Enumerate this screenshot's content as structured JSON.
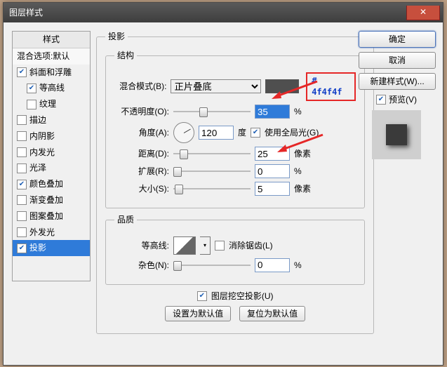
{
  "window": {
    "title": "图层样式"
  },
  "styles": {
    "header": "样式",
    "items": [
      {
        "label": "混合选项:默认",
        "default": true
      },
      {
        "label": "斜面和浮雕",
        "checked": true
      },
      {
        "label": "等高线",
        "checked": true,
        "indent": true
      },
      {
        "label": "纹理",
        "checked": false,
        "indent": true
      },
      {
        "label": "描边",
        "checked": false
      },
      {
        "label": "内阴影",
        "checked": false
      },
      {
        "label": "内发光",
        "checked": false
      },
      {
        "label": "光泽",
        "checked": false
      },
      {
        "label": "颜色叠加",
        "checked": true
      },
      {
        "label": "渐变叠加",
        "checked": false
      },
      {
        "label": "图案叠加",
        "checked": false
      },
      {
        "label": "外发光",
        "checked": false
      },
      {
        "label": "投影",
        "checked": true,
        "selected": true
      }
    ]
  },
  "main": {
    "group_label": "投影",
    "structure": {
      "legend": "结构",
      "blend_mode_label": "混合模式(B):",
      "blend_mode_value": "正片叠底",
      "color_hex": "# 4f4f4f",
      "opacity_label": "不透明度(O):",
      "opacity_value": "35",
      "opacity_unit": "%",
      "angle_label": "角度(A):",
      "angle_value": "120",
      "angle_unit": "度",
      "global_light_label": "使用全局光(G)",
      "global_light_checked": true,
      "distance_label": "距离(D):",
      "distance_value": "25",
      "distance_unit": "像素",
      "spread_label": "扩展(R):",
      "spread_value": "0",
      "spread_unit": "%",
      "size_label": "大小(S):",
      "size_value": "5",
      "size_unit": "像素"
    },
    "quality": {
      "legend": "品质",
      "contour_label": "等高线:",
      "antialias_label": "消除锯齿(L)",
      "antialias_checked": false,
      "noise_label": "杂色(N):",
      "noise_value": "0",
      "noise_unit": "%"
    },
    "knockout_label": "图层挖空投影(U)",
    "knockout_checked": true,
    "set_default": "设置为默认值",
    "reset_default": "复位为默认值"
  },
  "buttons": {
    "ok": "确定",
    "cancel": "取消",
    "new_style": "新建样式(W)...",
    "preview_label": "预览(V)",
    "preview_checked": true
  },
  "chart_data": {
    "type": "table",
    "title": "Drop Shadow settings",
    "rows": [
      {
        "param": "Blend Mode",
        "value": "Multiply"
      },
      {
        "param": "Color",
        "value": "#4f4f4f"
      },
      {
        "param": "Opacity",
        "value": 35,
        "unit": "%"
      },
      {
        "param": "Angle",
        "value": 120,
        "unit": "deg"
      },
      {
        "param": "Use Global Light",
        "value": true
      },
      {
        "param": "Distance",
        "value": 25,
        "unit": "px"
      },
      {
        "param": "Spread",
        "value": 0,
        "unit": "%"
      },
      {
        "param": "Size",
        "value": 5,
        "unit": "px"
      },
      {
        "param": "Noise",
        "value": 0,
        "unit": "%"
      },
      {
        "param": "Knocks Out",
        "value": true
      }
    ]
  }
}
